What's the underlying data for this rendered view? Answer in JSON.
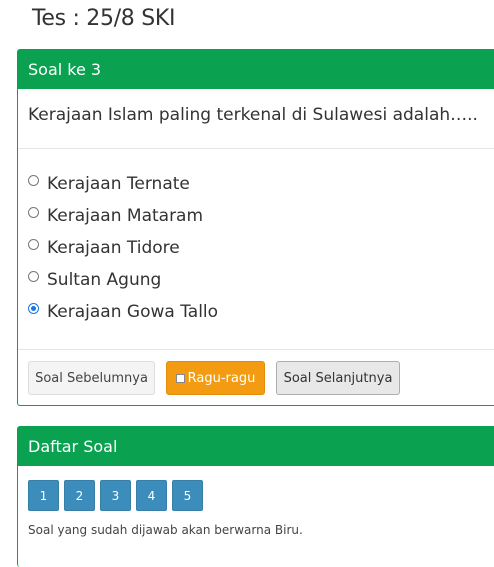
{
  "page_title": "Tes : 25/8 SKI",
  "question_panel": {
    "header": "Soal ke 3",
    "question": "Kerajaan Islam paling terkenal di Sulawesi adalah…..",
    "options": [
      {
        "label": "Kerajaan Ternate",
        "checked": false
      },
      {
        "label": "Kerajaan Mataram",
        "checked": false
      },
      {
        "label": "Kerajaan Tidore",
        "checked": false
      },
      {
        "label": "Sultan Agung",
        "checked": false
      },
      {
        "label": "Kerajaan Gowa Tallo",
        "checked": true
      }
    ],
    "buttons": {
      "prev": "Soal Sebelumnya",
      "ragu": "Ragu-ragu",
      "next": "Soal Selanjutnya"
    }
  },
  "list_panel": {
    "header": "Daftar Soal",
    "numbers": [
      "1",
      "2",
      "3",
      "4",
      "5"
    ],
    "note": "Soal yang sudah dijawab akan berwarna Biru."
  },
  "colors": {
    "header_green": "#0aa150",
    "answered_blue": "#3c8dbc",
    "ragu_orange": "#f39c12"
  }
}
